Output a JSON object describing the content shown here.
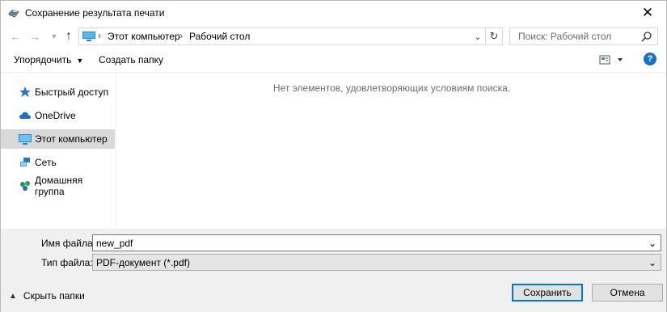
{
  "window": {
    "title": "Сохранение результата печати"
  },
  "nav": {
    "breadcrumb": [
      "Этот компьютер",
      "Рабочий стол"
    ],
    "search_placeholder": "Поиск: Рабочий стол"
  },
  "toolbar": {
    "organize_label": "Упорядочить",
    "new_folder_label": "Создать папку"
  },
  "sidebar": {
    "items": [
      {
        "label": "Быстрый доступ",
        "icon": "star-icon"
      },
      {
        "label": "OneDrive",
        "icon": "cloud-icon"
      },
      {
        "label": "Этот компьютер",
        "icon": "computer-icon",
        "selected": true
      },
      {
        "label": "Сеть",
        "icon": "network-icon"
      },
      {
        "label": "Домашняя группа",
        "icon": "homegroup-icon"
      }
    ]
  },
  "main": {
    "empty_message": "Нет элементов, удовлетворяющих условиям поиска."
  },
  "form": {
    "filename_label": "Имя файла:",
    "filename_value": "new_pdf",
    "filetype_label": "Тип файла:",
    "filetype_value": "PDF-документ (*.pdf)"
  },
  "footer": {
    "hide_folders_label": "Скрыть папки",
    "save_label": "Сохранить",
    "cancel_label": "Отмена"
  },
  "colors": {
    "accent": "#0078d7",
    "help": "#1a6fc6",
    "selected_bg": "#d9d9d9",
    "panel_bg": "#f0f0f0"
  }
}
